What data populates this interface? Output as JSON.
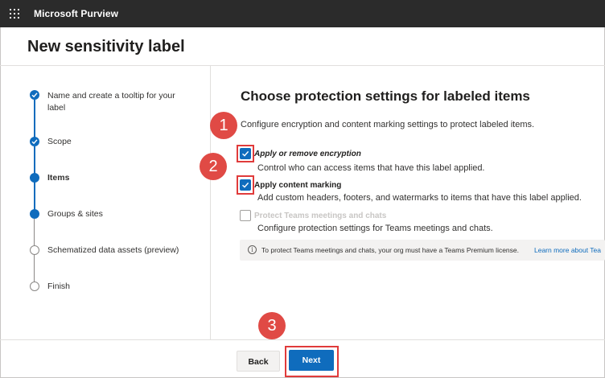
{
  "app": {
    "title": "Microsoft Purview"
  },
  "page": {
    "title": "New sensitivity label"
  },
  "steps": [
    {
      "label": "Name and create a tooltip for your label",
      "state": "done"
    },
    {
      "label": "Scope",
      "state": "done"
    },
    {
      "label": "Items",
      "state": "current"
    },
    {
      "label": "Groups & sites",
      "state": "upcoming-selected"
    },
    {
      "label": "Schematized data assets (preview)",
      "state": "upcoming"
    },
    {
      "label": "Finish",
      "state": "upcoming"
    }
  ],
  "main": {
    "heading": "Choose protection settings for labeled items",
    "description": "Configure encryption and content marking settings to protect labeled items.",
    "options": [
      {
        "label": "Apply or remove encryption",
        "description": "Control who can access items that have this label applied.",
        "checked": true,
        "disabled": false
      },
      {
        "label": "Apply content marking",
        "description": "Add custom headers, footers, and watermarks to items that have this label applied.",
        "checked": true,
        "disabled": false
      },
      {
        "label": "Protect Teams meetings and chats",
        "description": "Configure protection settings for Teams meetings and chats.",
        "checked": false,
        "disabled": true
      }
    ],
    "info": {
      "text": "To protect Teams meetings and chats, your org must have a Teams Premium license.",
      "link": "Learn more about Tea"
    }
  },
  "footer": {
    "back_label": "Back",
    "next_label": "Next"
  },
  "annotations": {
    "badge1": "1",
    "badge2": "2",
    "badge3": "3"
  },
  "colors": {
    "accent": "#0f6cbd",
    "highlight": "#e03b3b",
    "badge": "#e04a45",
    "topbar": "#2b2b2b"
  }
}
